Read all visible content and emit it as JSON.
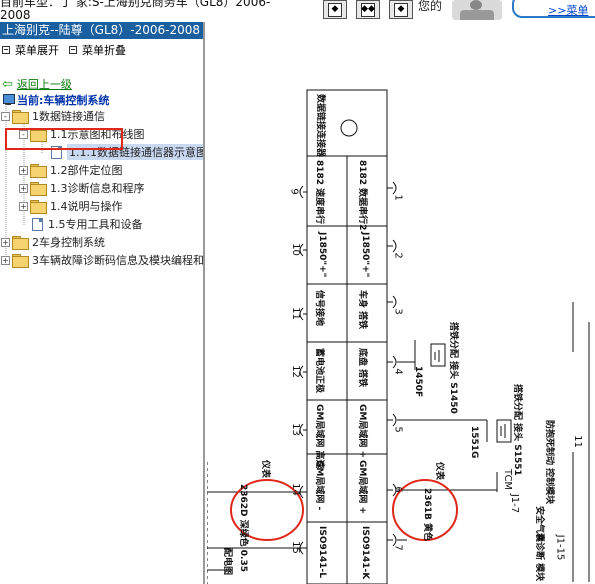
{
  "topbar": {
    "vehicle": "目前车型：丁 家:S-上海别克商务车（GL8）2006-",
    "vehicle_year": "2008",
    "who": "您的",
    "more_label": ">>菜单",
    "nav_buttons": [
      "◆",
      "◆◆",
      "◆"
    ]
  },
  "tree": {
    "title": "上海别克--陆尊（GL8）-2006-2008",
    "expand_all": "菜单展开",
    "collapse_all": "菜单折叠",
    "back": "返回上一级",
    "current": "当前:车辆控制系统",
    "items": [
      {
        "label": "1数据链接通信",
        "expander": "-",
        "type": "folder"
      },
      {
        "label": "1.1示意图和布线图",
        "expander": "-",
        "type": "folder"
      },
      {
        "label": "1.1.1数据链接通信器示意图",
        "expander": "",
        "type": "doc"
      },
      {
        "label": "1.2部件定位图",
        "expander": "+",
        "type": "folder"
      },
      {
        "label": "1.3诊断信息和程序",
        "expander": "+",
        "type": "folder"
      },
      {
        "label": "1.4说明与操作",
        "expander": "+",
        "type": "folder"
      },
      {
        "label": "1.5专用工具和设备",
        "expander": "",
        "type": "doc"
      },
      {
        "label": "2车身控制系统",
        "expander": "+",
        "type": "folder"
      },
      {
        "label": "3车辆故障诊断码信息及模块编程和",
        "expander": "+",
        "type": "folder"
      }
    ]
  },
  "diagram": {
    "header": "数据链接连接器",
    "pins_left": [
      "9",
      "10",
      "11",
      "12",
      "13",
      "14",
      "15"
    ],
    "pins_right": [
      "1",
      "2",
      "3",
      "4",
      "5",
      "6",
      "7"
    ],
    "labels_left_col": [
      "8182 速度串行",
      "J1850\"+\"",
      "信号接地",
      "蓄电池正极",
      "GM局域网 高速",
      "GM局域网 -",
      "ISO9141-L"
    ],
    "labels_right_col": [
      "8182 数据串行2",
      "J1850\"+\"",
      "车身 搭铁",
      "底盘 搭铁",
      "GM局域网 +",
      "GM局域网 +",
      "ISO9141-K"
    ],
    "wire_left": "2362D 深绿色 0.35",
    "wire_left_tag": "仪表",
    "wire_right": "2361B 黄色",
    "wire_right_tag": "仪表",
    "ground_labels": [
      "1450F",
      "1551G"
    ],
    "ground_tags": [
      "搭铁分配 接头 S1450",
      "搭铁分配 接头 S1551"
    ],
    "tcm": "TCM",
    "tcm_pin": "J1-7",
    "right_col_labels": [
      "防抱死制动 控制模块",
      "安全气囊诊断 模块",
      "J1-15"
    ],
    "right_pin": "11",
    "bottom_tag": "配电图"
  }
}
